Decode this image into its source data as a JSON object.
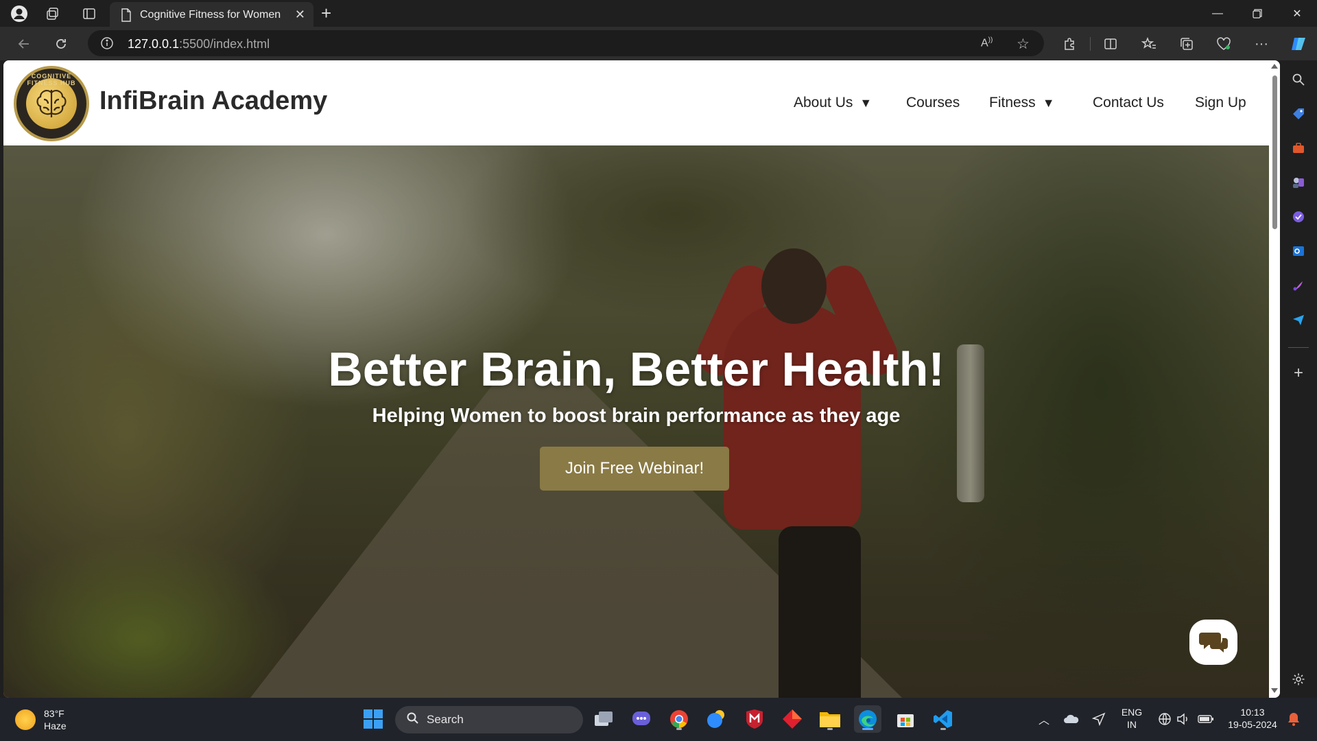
{
  "browser": {
    "tab_title": "Cognitive Fitness for Women",
    "url_host": "127.0.0.1",
    "url_rest": ":5500/index.html"
  },
  "site": {
    "brand": "InfiBrain Academy",
    "logo_ring_text": "COGNITIVE FITNESS HUB",
    "nav": [
      {
        "label": "About Us",
        "caret": "▼"
      },
      {
        "label": "Courses",
        "caret": ""
      },
      {
        "label": "Fitness",
        "caret": "▼"
      },
      {
        "label": "Contact Us",
        "caret": ""
      },
      {
        "label": "Sign Up",
        "caret": ""
      }
    ]
  },
  "hero": {
    "title": "Better Brain, Better Health!",
    "subtitle": "Helping Women to boost brain performance as they age",
    "cta_label": "Join Free Webinar!"
  },
  "taskbar": {
    "weather_temp": "83°F",
    "weather_desc": "Haze",
    "search_label": "Search",
    "lang_top": "ENG",
    "lang_bottom": "IN",
    "time": "10:13",
    "date": "19-05-2024"
  },
  "colors": {
    "accent_button": "#8a7a45",
    "brand_text": "#2a2a2a"
  }
}
